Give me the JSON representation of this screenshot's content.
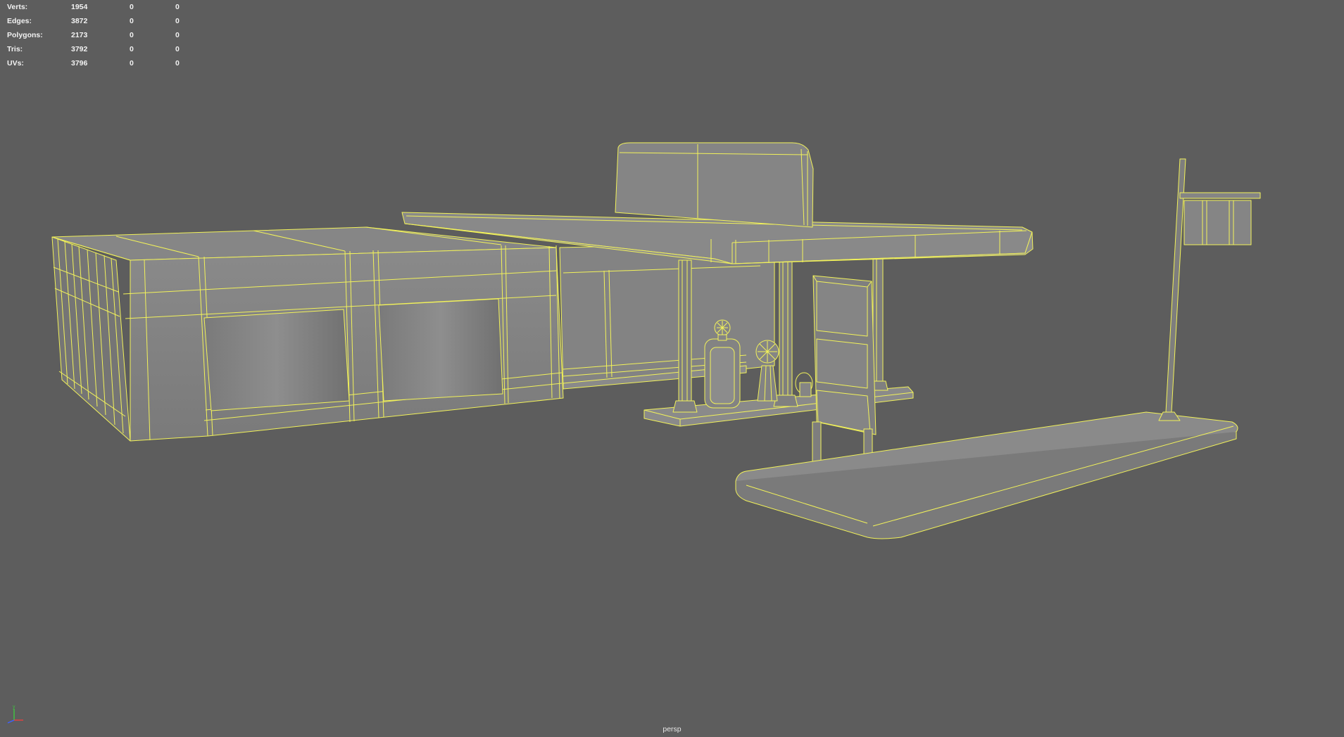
{
  "viewport": {
    "camera": "persp",
    "background": "#5d5d5d",
    "wire_color": "#f2f25a",
    "fill_color": "#7c7c7c"
  },
  "hud": {
    "rows": [
      {
        "label": "Verts:",
        "total": "1954",
        "selected": "0",
        "selected_b": "0"
      },
      {
        "label": "Edges:",
        "total": "3872",
        "selected": "0",
        "selected_b": "0"
      },
      {
        "label": "Polygons:",
        "total": "2173",
        "selected": "0",
        "selected_b": "0"
      },
      {
        "label": "Tris:",
        "total": "3792",
        "selected": "0",
        "selected_b": "0"
      },
      {
        "label": "UVs:",
        "total": "3796",
        "selected": "0",
        "selected_b": "0"
      }
    ]
  },
  "axis_gizmo": {
    "y_label": "y",
    "x_color": "#e04040",
    "y_color": "#40c040",
    "z_color": "#4060ff"
  }
}
